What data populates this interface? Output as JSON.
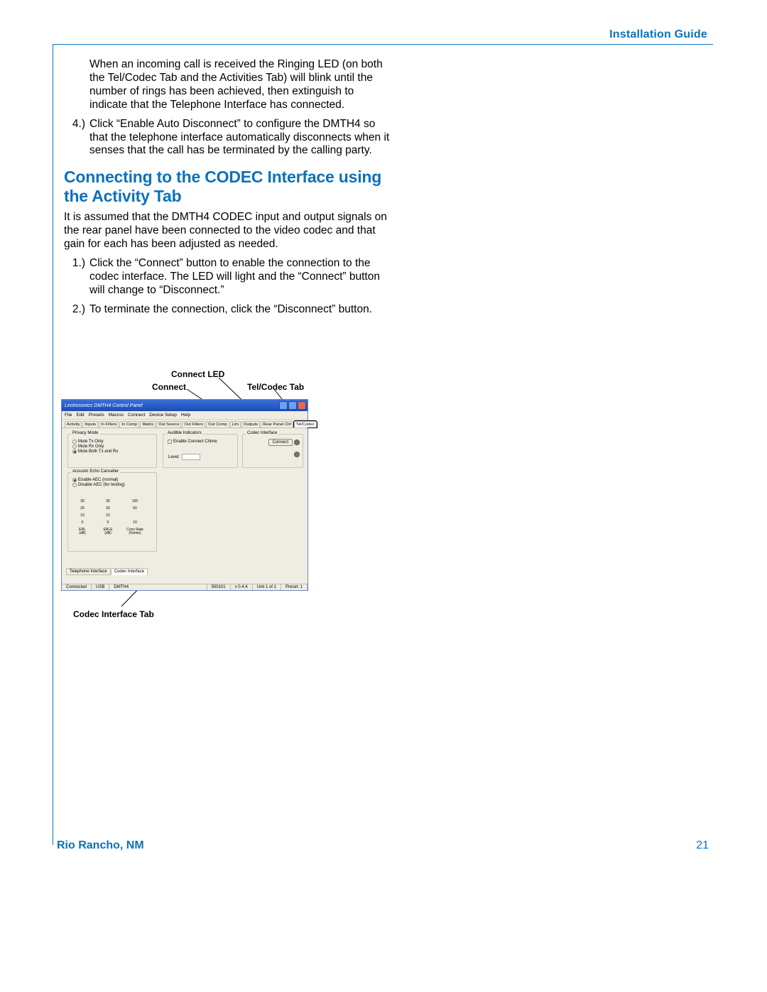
{
  "header": {
    "label": "Installation Guide"
  },
  "footer": {
    "left": "Rio Rancho, NM",
    "page": "21"
  },
  "body": {
    "intro_para": "When an incoming call is received the Ringing LED (on both the Tel/Codec Tab and the Activities Tab) will blink until the number of rings has been achieved, then extinguish to indicate that the Telephone Interface has connected.",
    "item4_num": "4.)",
    "item4": "Click “Enable Auto Disconnect” to configure the DMTH4 so that the telephone interface automati­cally disconnects when it senses that the call has be terminated by the calling party.",
    "heading": "Connecting to the CODEC Interface using the Activity Tab",
    "codec_intro": "It is assumed that the DMTH4 CODEC input and output signals on the rear panel have been connected to the video codec and that gain for each has been adjusted as needed.",
    "codec1_num": "1.)",
    "codec1": "Click the “Connect” button to enable the connec­tion to the codec interface. The LED will light and the “Connect” button will change to “Disconnect.”",
    "codec2_num": "2.)",
    "codec2": "To terminate the connection, click the “Disconnect” button."
  },
  "callouts": {
    "connect_led": "Connect LED",
    "connect": "Connect",
    "telcodec_tab": "Tel/Codec Tab",
    "codec_iface_tab": "Codec Interface Tab"
  },
  "window": {
    "title": "Lectrosonics DMTH4 Control Panel",
    "menus": [
      "File",
      "Edit",
      "Presets",
      "Macros",
      "Connect",
      "Device Setup",
      "Help"
    ],
    "tabs": [
      "Activity",
      "Inputs",
      "In Filters",
      "In Comp",
      "Matrix",
      "Out Source",
      "Out Filters",
      "Out Comp",
      "Lim",
      "Outputs",
      "Rear Panel Ctrl",
      "Tel/Codec"
    ],
    "active_tab": "Tel/Codec",
    "privacy": {
      "title": "Privacy Mode",
      "opt1": "Mute Tx Only",
      "opt2": "Mute Rx Only",
      "opt3": "Mute Both Tx and Rx"
    },
    "audible": {
      "title": "Audible Indicators",
      "chk": "Enable Connect Chime",
      "level_label": "Level:"
    },
    "codec_box": {
      "title": "Codec Interface",
      "btn": "Connect"
    },
    "aec": {
      "title": "Acoustic Echo Canceller",
      "opt1": "Enable AEC (normal)",
      "opt2": "Disable AEC (for testing)",
      "col1_ticks": [
        "30",
        "20",
        "10",
        "0"
      ],
      "col1_label": "ERL",
      "col1_unit": "(dB)",
      "col2_ticks": [
        "30",
        "20",
        "10",
        "0"
      ],
      "col2_label": "ERLE",
      "col2_unit": "(dB)",
      "col3_ticks": [
        "100",
        "50",
        "10"
      ],
      "col3_label": "Conv Rate",
      "col3_unit": "(%/min)"
    },
    "bottom_tabs": {
      "tel": "Telephone Interface",
      "codec": "Codec Interface"
    },
    "status": {
      "conn": "Connected",
      "link": "USB",
      "dev": "DMTH4",
      "serial": "500101",
      "ver": "v 0.4.4",
      "unit": "Unit 1 of 1",
      "preset": "Preset: 1"
    }
  }
}
